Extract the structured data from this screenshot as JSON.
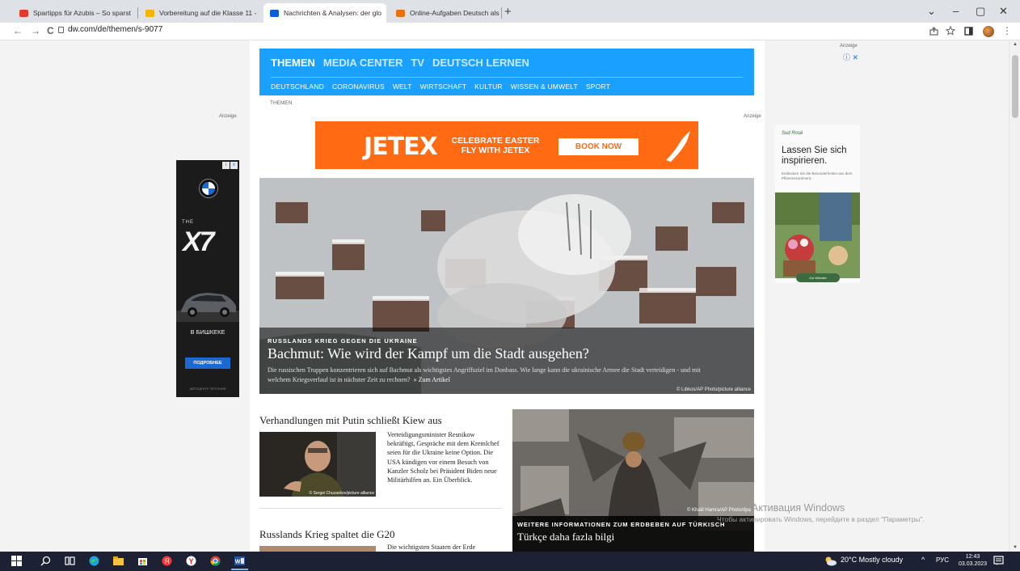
{
  "browser": {
    "tabs": [
      {
        "title": "Spartipps für Azubis – So sparst",
        "favicon_color": "#e23b2e",
        "active": false
      },
      {
        "title": "Vorbereitung auf die Klasse 11 -",
        "favicon_color": "#f4b400",
        "active": false
      },
      {
        "title": "Nachrichten & Analysen: der glo",
        "favicon_color": "#0b5ed7",
        "active": true
      },
      {
        "title": "Online-Aufgaben Deutsch als Fre",
        "favicon_color": "#e8710a",
        "active": false
      }
    ],
    "tab_close_glyph": "×",
    "new_tab_glyph": "+",
    "window_controls": [
      "⌄",
      "–",
      "▢",
      "✕"
    ],
    "url": "dw.com/de/themen/s-9077",
    "nav": {
      "back": "←",
      "forward": "→",
      "reload": "C"
    },
    "toolbar_icons": [
      "share-icon",
      "star-icon",
      "sidepanel-icon",
      "extension-avatar"
    ]
  },
  "site": {
    "brand_color": "#1aa0ff",
    "main_nav": [
      "THEMEN",
      "MEDIA CENTER",
      "TV",
      "DEUTSCH LERNEN"
    ],
    "sub_nav": [
      "DEUTSCHLAND",
      "CORONAVIRUS",
      "WELT",
      "WIRTSCHAFT",
      "KULTUR",
      "WISSEN & UMWELT",
      "SPORT"
    ],
    "breadcrumb": "THEMEN",
    "ad_label": "Anzeige"
  },
  "banner_ad": {
    "logo": "JETEX",
    "headline_1": "CELEBRATE EASTER",
    "headline_2": "FLY WITH JETEX",
    "cta": "BOOK NOW",
    "color": "#ff6a13"
  },
  "hero": {
    "kicker": "RUSSLANDS KRIEG GEGEN DIE UKRAINE",
    "title": "Bachmut: Wie wird der Kampf um die Stadt ausgehen?",
    "teaser": "Die russischen Truppen konzentrieren sich auf Bachmut als wichtigstes Angriffsziel im Donbass. Wie lange kann die ukrainische Armee die Stadt verteidigen - und mit welchem Kriegsverlauf ist in nächster Zeit zu rechnen?",
    "more": "» Zum Artikel",
    "credit": "© Libkos/AP Photo/picture alliance"
  },
  "story1": {
    "title": "Verhandlungen mit Putin schließt Kiew aus",
    "text": "Verteidigungsminister Resnikow bekräftigt, Gespräche mit dem Kremlchef seien für die Ukraine keine Option. Die USA kündigen vor einem Besuch von Kanzler Scholz bei Präsident Biden neue Militärhilfen an. Ein Überblick.",
    "credit": "© Sergei Chuzavkov/picture alliance"
  },
  "story2": {
    "title": "Russlands Krieg spaltet die G20",
    "text": "Die wichtigsten Staaten der Erde"
  },
  "story3": {
    "kicker": "WEITERE INFORMATIONEN ZUM ERDBEBEN AUF TÜRKISCH",
    "title": "Türkçe daha fazla bilgi",
    "credit": "© Khalil Hamra/AP Photo/dpa"
  },
  "ad_left": {
    "the": "THE",
    "model": "X7",
    "city": "В БИШКЕКЕ",
    "cta": "ПОДРОБНЕЕ",
    "footer": "АВТОЦЕНТР ЭСТОНИЯ",
    "brand_icon": "bmw-logo"
  },
  "ad_right": {
    "brand": "Sud Rosé",
    "headline": "Lassen Sie sich inspirieren.",
    "sub": "Entdecken Sie die Besonderheiten aus dem Pflanzensortiment.",
    "cta": "Zur Website",
    "adchoice": "ⓘ ✕"
  },
  "os": {
    "watermark_title": "Активация Windows",
    "watermark_text": "Чтобы активировать Windows, перейдите в раздел \"Параметры\".",
    "weather": "20°C  Mostly cloudy",
    "lang": "РУС",
    "tray_chevron": "^",
    "time": "12:43",
    "date": "03.03.2023"
  }
}
